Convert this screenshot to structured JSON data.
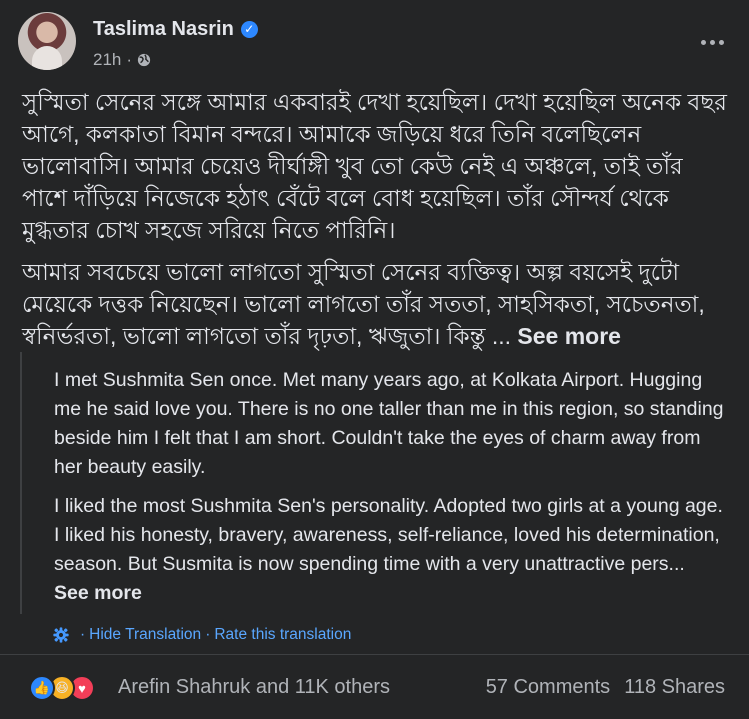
{
  "post": {
    "author": "Taslima Nasrin",
    "time": "21h",
    "body_bn": [
      "সুস্মিতা সেনের সঙ্গে আমার একবারই দেখা হয়েছিল। দেখা হয়েছিল অনেক বছর আগে, কলকাতা বিমান বন্দরে।   আমাকে জড়িয়ে ধরে তিনি বলেছিলেন ভালোবাসি। আমার চেয়েও দীর্ঘাঙ্গী খুব তো কেউ নেই এ অঞ্চলে, তাই তাঁর পাশে দাঁড়িয়ে নিজেকে হঠাৎ বেঁটে বলে বোধ হয়েছিল। তাঁর সৌন্দর্য থেকে মুগ্ধতার চোখ সহজে  সরিয়ে নিতে  পারিনি।",
      "আমার সবচেয়ে ভালো লাগতো সুস্মিতা সেনের ব্যক্তিত্ব।   অল্প বয়সেই দুটো মেয়েকে দত্তক নিয়েছেন। ভালো লাগতো তাঁর সততা, সাহসিকতা, সচেতনতা, স্বনির্ভরতা, ভালো লাগতো তাঁর দৃঢ়তা, ঋজুতা। কিন্তু ..."
    ],
    "see_more": "See more",
    "translation": [
      "I met Sushmita Sen once. Met many years ago, at Kolkata Airport. Hugging me he said love you. There is no one taller than me in this region, so standing beside him I felt that I am short. Couldn't take the eyes of charm away from her beauty easily.",
      "I liked the most Sushmita Sen's personality. Adopted two girls at a young age. I liked his honesty, bravery, awareness, self-reliance, loved his determination, season. But Susmita is now spending time with a very unattractive pers..."
    ],
    "translation_see_more": "See more",
    "hide_translation": "Hide Translation",
    "separator": "·",
    "rate_translation": "Rate this translation",
    "reactors": "Arefin Shahruk and 11K others",
    "comments": "57 Comments",
    "shares": "118 Shares"
  },
  "icons": {
    "verified": "verified-badge-icon",
    "audience": "globe-icon",
    "more": "more-options-icon",
    "translate": "gear-icon",
    "reactions": [
      "like-icon",
      "haha-icon",
      "love-icon"
    ]
  },
  "colors": {
    "background": "#242526",
    "text": "#e4e6eb",
    "secondary": "#b0b3b8",
    "link": "#5aa7ff",
    "verified": "#2d88ff"
  }
}
